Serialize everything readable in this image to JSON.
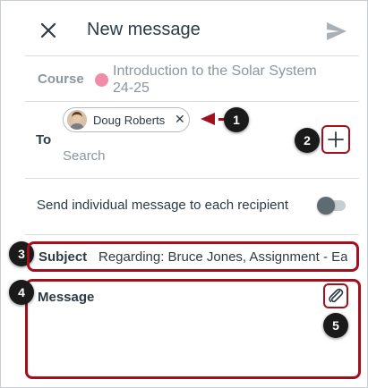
{
  "header": {
    "title": "New message",
    "close_icon": "close-icon",
    "send_icon": "send-icon"
  },
  "course": {
    "label": "Course",
    "name": "Introduction to the Solar System 24-25",
    "dot_color": "#ef8ca8"
  },
  "to": {
    "label": "To",
    "recipient": "Doug Roberts",
    "remove_symbol": "✕",
    "search_placeholder": "Search",
    "add_icon": "plus-icon"
  },
  "individual": {
    "label": "Send individual message to each recipient",
    "enabled": false
  },
  "subject": {
    "label": "Subject",
    "value": "Regarding: Bruce Jones, Assignment - Ea"
  },
  "message": {
    "label": "Message",
    "attach_icon": "paperclip-icon"
  },
  "callouts": [
    "1",
    "2",
    "3",
    "4",
    "5"
  ],
  "colors": {
    "callout_red": "#a3101d",
    "text": "#2d3b45",
    "muted": "#8b969e"
  }
}
